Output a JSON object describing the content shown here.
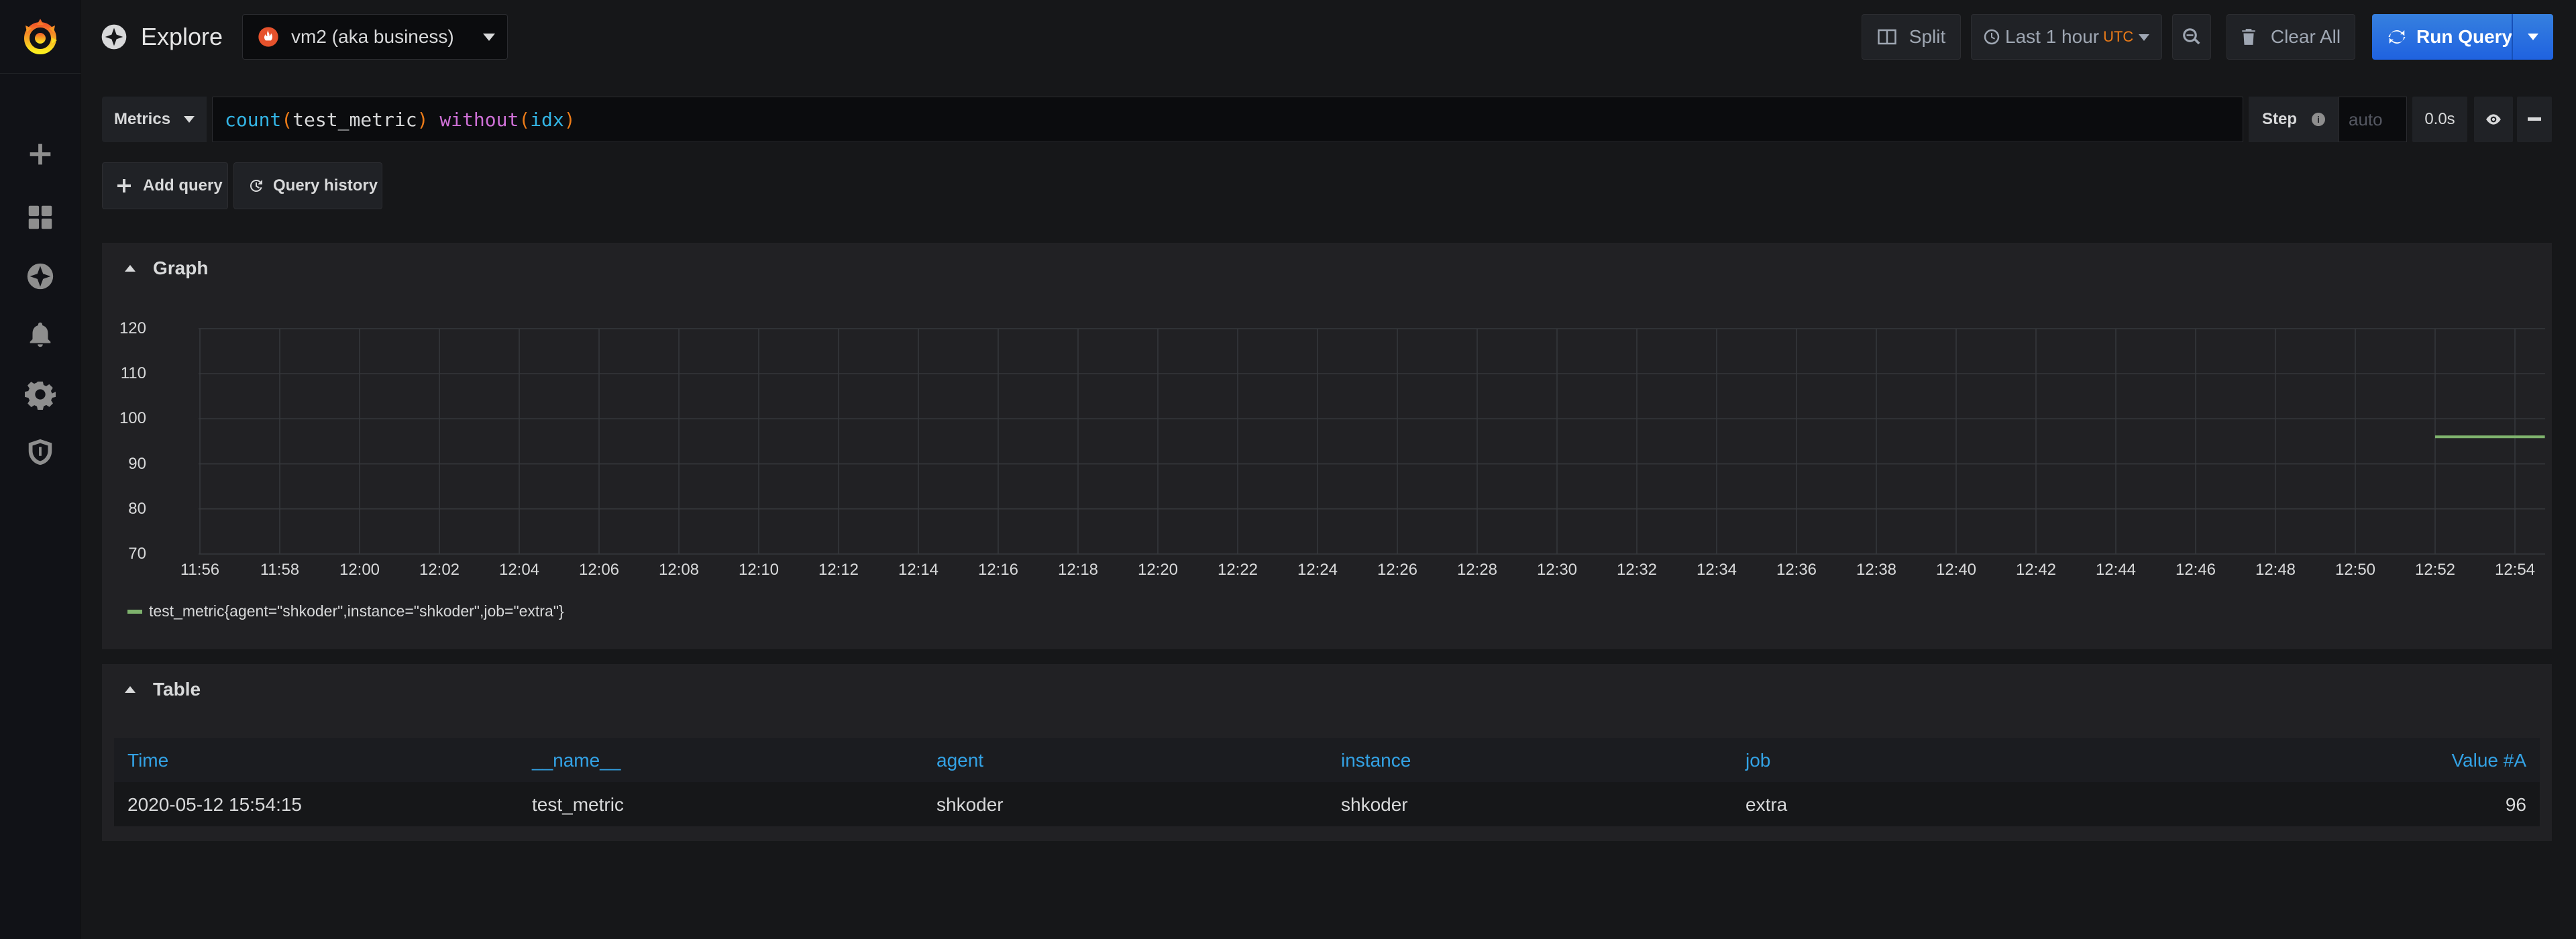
{
  "header": {
    "title": "Explore",
    "datasource": "vm2 (aka business)",
    "split_label": "Split",
    "time_range": "Last 1 hour",
    "timezone": "UTC",
    "clear_all_label": "Clear All",
    "run_query_label": "Run Query"
  },
  "query": {
    "metrics_label": "Metrics",
    "expr": {
      "fn": "count",
      "open1": "(",
      "metric": "test_metric",
      "close1": ")",
      "kw": "without",
      "open2": "(",
      "label": "idx",
      "close2": ")"
    },
    "step_label": "Step",
    "step_placeholder": "auto",
    "step_value": "0.0s",
    "add_query_label": "Add query",
    "query_history_label": "Query history"
  },
  "graph_panel": {
    "title": "Graph",
    "legend": "test_metric{agent=\"shkoder\",instance=\"shkoder\",job=\"extra\"}",
    "series_color": "#7eb26d"
  },
  "chart_data": {
    "type": "line",
    "x_ticks": [
      "11:56",
      "11:58",
      "12:00",
      "12:02",
      "12:04",
      "12:06",
      "12:08",
      "12:10",
      "12:12",
      "12:14",
      "12:16",
      "12:18",
      "12:20",
      "12:22",
      "12:24",
      "12:26",
      "12:28",
      "12:30",
      "12:32",
      "12:34",
      "12:36",
      "12:38",
      "12:40",
      "12:42",
      "12:44",
      "12:46",
      "12:48",
      "12:50",
      "12:52",
      "12:54"
    ],
    "y_ticks": [
      120,
      110,
      100,
      90,
      80,
      70
    ],
    "ylim": [
      70,
      120
    ],
    "grid": true,
    "legend_placement": "bottom-left",
    "series": [
      {
        "name": "test_metric{agent=\"shkoder\",instance=\"shkoder\",job=\"extra\"}",
        "color": "#7eb26d",
        "points": [
          [
            "12:52",
            96
          ],
          [
            "12:54:45",
            96
          ]
        ]
      }
    ]
  },
  "table_panel": {
    "title": "Table",
    "columns": [
      "Time",
      "__name__",
      "agent",
      "instance",
      "job",
      "Value #A"
    ],
    "rows": [
      [
        "2020-05-12 15:54:15",
        "test_metric",
        "shkoder",
        "shkoder",
        "extra",
        "96"
      ]
    ]
  }
}
